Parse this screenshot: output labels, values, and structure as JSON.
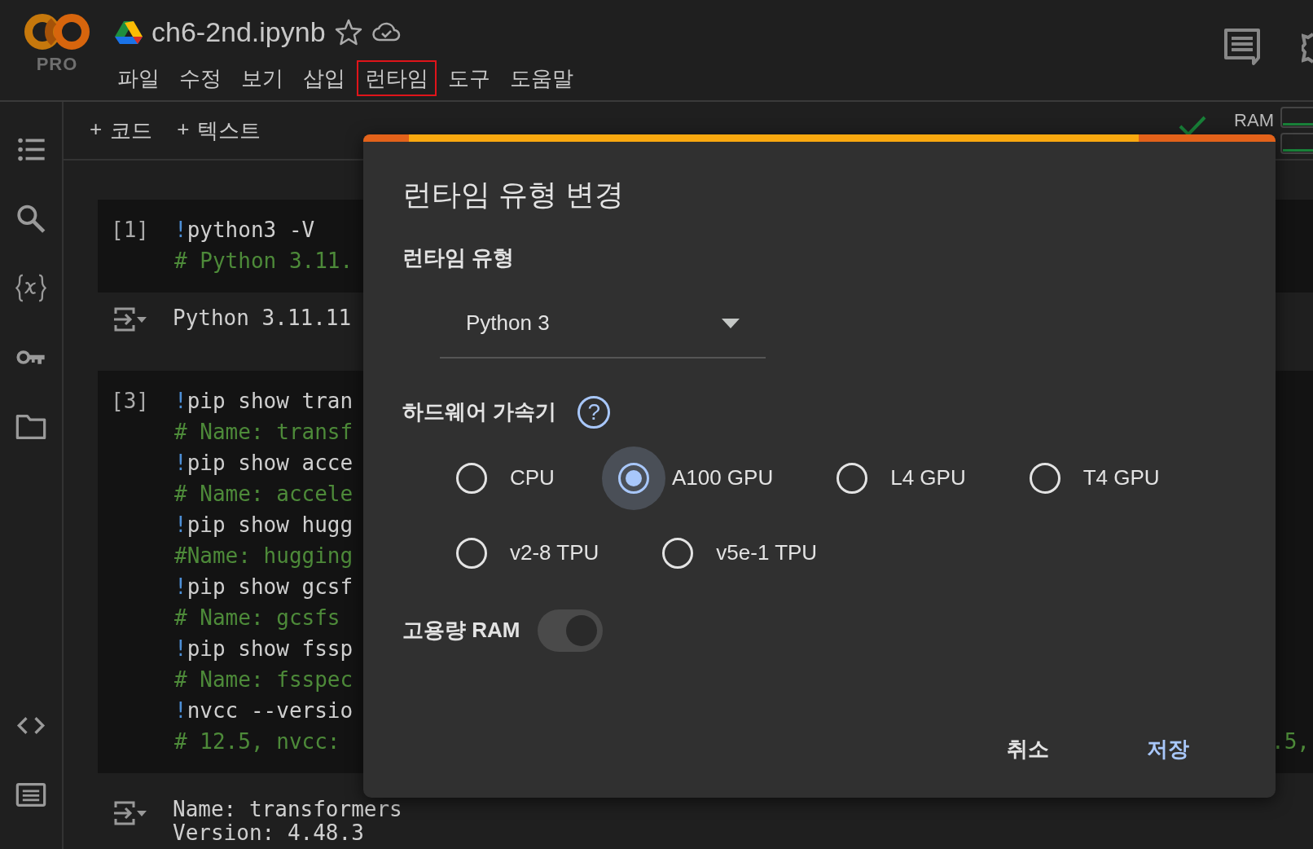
{
  "app": {
    "badge": "PRO"
  },
  "notebook": {
    "title": "ch6-2nd.ipynb"
  },
  "menu": [
    {
      "label": "파일",
      "highlighted": false
    },
    {
      "label": "수정",
      "highlighted": false
    },
    {
      "label": "보기",
      "highlighted": false
    },
    {
      "label": "삽입",
      "highlighted": false
    },
    {
      "label": "런타임",
      "highlighted": true
    },
    {
      "label": "도구",
      "highlighted": false
    },
    {
      "label": "도움말",
      "highlighted": false
    }
  ],
  "toolbar": {
    "buttons": [
      {
        "icon": "+",
        "label": "코드"
      },
      {
        "icon": "+",
        "label": "텍스트"
      }
    ],
    "resource_label": "RAM"
  },
  "cells": [
    {
      "prompt": "[1]",
      "lines": [
        {
          "kind": "command",
          "mark": "!",
          "text": "python3 -V"
        },
        {
          "kind": "comment",
          "text": "# Python 3.11."
        }
      ],
      "output": [
        "Python 3.11.11"
      ]
    },
    {
      "prompt": "[3]",
      "lines": [
        {
          "kind": "command",
          "mark": "!",
          "text": "pip show tran"
        },
        {
          "kind": "comment",
          "text": "# Name: transf"
        },
        {
          "kind": "command",
          "mark": "!",
          "text": "pip show acce"
        },
        {
          "kind": "comment",
          "text": "# Name: accele"
        },
        {
          "kind": "command",
          "mark": "!",
          "text": "pip show hugg"
        },
        {
          "kind": "comment",
          "text": "#Name: hugging"
        },
        {
          "kind": "command",
          "mark": "!",
          "text": "pip show gcsf"
        },
        {
          "kind": "comment",
          "text": "# Name: gcsfs"
        },
        {
          "kind": "command",
          "mark": "!",
          "text": "pip show fssp"
        },
        {
          "kind": "comment",
          "text": "# Name: fsspec"
        },
        {
          "kind": "command",
          "mark": "!",
          "text": "nvcc --versio"
        },
        {
          "kind": "comment",
          "text": "# 12.5, nvcc:",
          "tail": ".5,"
        }
      ],
      "output": [
        "Name: transformers",
        "Version: 4.48.3"
      ]
    }
  ],
  "dialog": {
    "title": "런타임 유형 변경",
    "runtime_label": "런타임 유형",
    "runtime_value": "Python 3",
    "accelerator_label": "하드웨어 가속기",
    "help_icon": "?",
    "accelerators": [
      [
        {
          "label": "CPU",
          "selected": false
        },
        {
          "label": "A100 GPU",
          "selected": true
        },
        {
          "label": "L4 GPU",
          "selected": false
        },
        {
          "label": "T4 GPU",
          "selected": false
        }
      ],
      [
        {
          "label": "v2-8 TPU",
          "selected": false
        },
        {
          "label": "v5e-1 TPU",
          "selected": false
        }
      ]
    ],
    "high_ram": {
      "label": "고용량 RAM",
      "on": true,
      "disabled": true
    },
    "buttons": [
      {
        "label": "취소",
        "kind": "secondary"
      },
      {
        "label": "저장",
        "kind": "primary"
      }
    ]
  }
}
